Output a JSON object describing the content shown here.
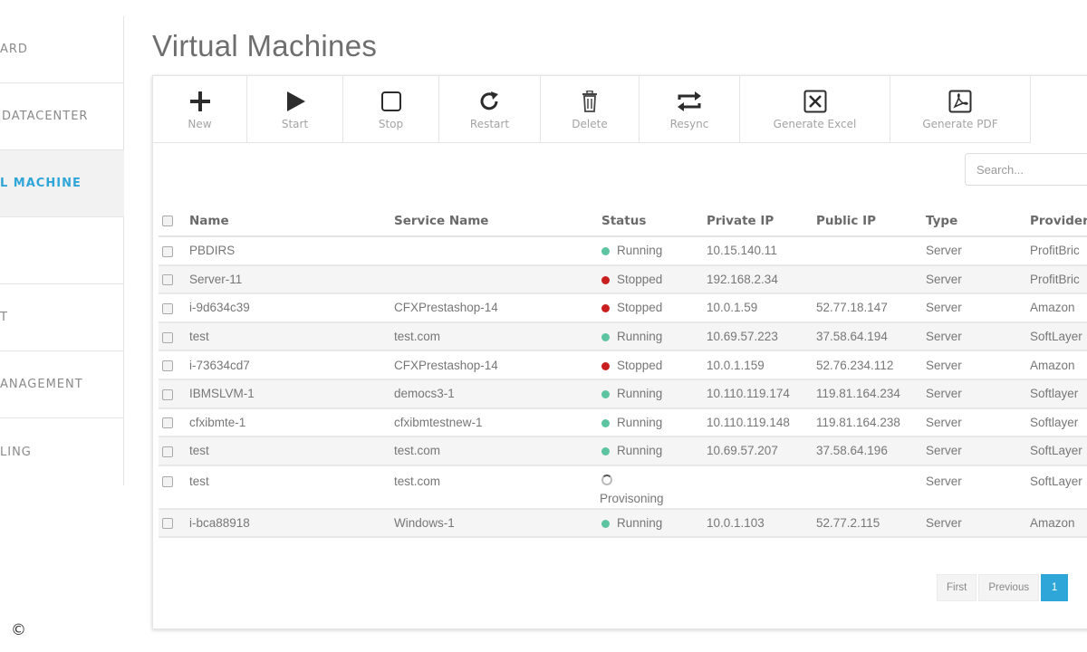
{
  "sidebar": {
    "items": [
      {
        "label": "ARD",
        "active": false
      },
      {
        "label": "DATACENTER",
        "active": false
      },
      {
        "label": "L MACHINE",
        "active": true
      },
      {
        "label": "",
        "active": false
      },
      {
        "label": "T",
        "active": false
      },
      {
        "label": "ANAGEMENT",
        "active": false
      },
      {
        "label": "LING",
        "active": false
      }
    ]
  },
  "page_title": "Virtual Machines",
  "toolbar": {
    "buttons": [
      {
        "label": "New",
        "icon": "plus-icon"
      },
      {
        "label": "Start",
        "icon": "play-icon"
      },
      {
        "label": "Stop",
        "icon": "stop-icon"
      },
      {
        "label": "Restart",
        "icon": "restart-icon"
      },
      {
        "label": "Delete",
        "icon": "trash-icon"
      },
      {
        "label": "Resync",
        "icon": "resync-icon"
      },
      {
        "label": "Generate Excel",
        "icon": "excel-icon"
      },
      {
        "label": "Generate PDF",
        "icon": "pdf-icon"
      }
    ]
  },
  "search": {
    "placeholder": "Search..."
  },
  "table": {
    "headers": [
      "Name",
      "Service Name",
      "Status",
      "Private IP",
      "Public IP",
      "Type",
      "Provider"
    ],
    "rows": [
      {
        "name": "PBDIRS",
        "service": "",
        "status": "Running",
        "private_ip": "10.15.140.11",
        "public_ip": "",
        "type": "Server",
        "provider": "ProfitBric"
      },
      {
        "name": "Server-11",
        "service": "",
        "status": "Stopped",
        "private_ip": "192.168.2.34",
        "public_ip": "",
        "type": "Server",
        "provider": "ProfitBric"
      },
      {
        "name": "i-9d634c39",
        "service": "CFXPrestashop-14",
        "status": "Stopped",
        "private_ip": "10.0.1.59",
        "public_ip": "52.77.18.147",
        "type": "Server",
        "provider": "Amazon"
      },
      {
        "name": "test",
        "service": "test.com",
        "status": "Running",
        "private_ip": "10.69.57.223",
        "public_ip": "37.58.64.194",
        "type": "Server",
        "provider": "SoftLayer"
      },
      {
        "name": "i-73634cd7",
        "service": "CFXPrestashop-14",
        "status": "Stopped",
        "private_ip": "10.0.1.159",
        "public_ip": "52.76.234.112",
        "type": "Server",
        "provider": "Amazon"
      },
      {
        "name": "IBMSLVM-1",
        "service": "democs3-1",
        "status": "Running",
        "private_ip": "10.110.119.174",
        "public_ip": "119.81.164.234",
        "type": "Server",
        "provider": "Softlayer"
      },
      {
        "name": "cfxibmte-1",
        "service": "cfxibmtestnew-1",
        "status": "Running",
        "private_ip": "10.110.119.148",
        "public_ip": "119.81.164.238",
        "type": "Server",
        "provider": "Softlayer"
      },
      {
        "name": "test",
        "service": "test.com",
        "status": "Running",
        "private_ip": "10.69.57.207",
        "public_ip": "37.58.64.196",
        "type": "Server",
        "provider": "SoftLayer"
      },
      {
        "name": "test",
        "service": "test.com",
        "status": "Provisoning",
        "private_ip": "",
        "public_ip": "",
        "type": "Server",
        "provider": "SoftLayer"
      },
      {
        "name": "i-bca88918",
        "service": "Windows-1",
        "status": "Running",
        "private_ip": "10.0.1.103",
        "public_ip": "52.77.2.115",
        "type": "Server",
        "provider": "Amazon"
      }
    ]
  },
  "status_colors": {
    "Running": "#5cc4a0",
    "Stopped": "#c81e1e"
  },
  "pagination": {
    "first": "First",
    "previous": "Previous",
    "current": "1"
  },
  "copyright": "©"
}
